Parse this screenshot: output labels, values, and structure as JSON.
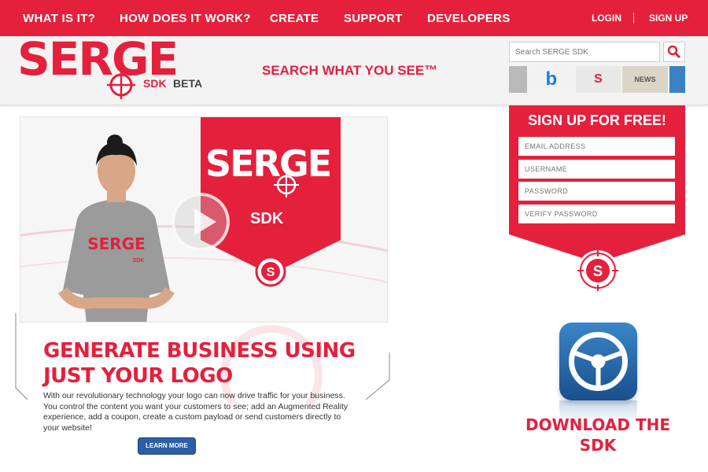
{
  "nav": {
    "items": [
      "WHAT IS IT?",
      "HOW DOES IT WORK?",
      "CREATE",
      "SUPPORT",
      "DEVELOPERS"
    ],
    "login": "LOGIN",
    "signup": "SIGN UP"
  },
  "brand": {
    "logo": "SERGE",
    "sub": "SDK",
    "beta": "BETA",
    "tagline": "SEARCH WHAT YOU SEE™"
  },
  "search": {
    "placeholder": "Search SERGE SDK"
  },
  "strip": [
    "",
    "b",
    "S",
    "NEWS",
    ""
  ],
  "video": {
    "banner_logo": "SERGE",
    "banner_sub": "SDK",
    "shirt_logo": "SERGE",
    "shirt_sub": "SDK"
  },
  "hero": {
    "headline_line1": "GENERATE BUSINESS USING",
    "headline_line2": "JUST YOUR LOGO",
    "body": "With our revolutionary technology your logo can now drive traffic for your business. You control the content you want your customers to see; add an Augmented Reality experience, add a coupon, create a custom payload or send customers directly to your website!",
    "button": "LEARN MORE"
  },
  "signup_form": {
    "title": "SIGN UP FOR FREE!",
    "email": "EMAIL ADDRESS",
    "username": "USERNAME",
    "password": "PASSWORD",
    "verify": "VERIFY PASSWORD",
    "badge": "S"
  },
  "download": {
    "line1": "DOWNLOAD THE",
    "line2": "SDK"
  },
  "colors": {
    "brand_red": "#e4203d",
    "button_blue": "#2a5fa6"
  }
}
